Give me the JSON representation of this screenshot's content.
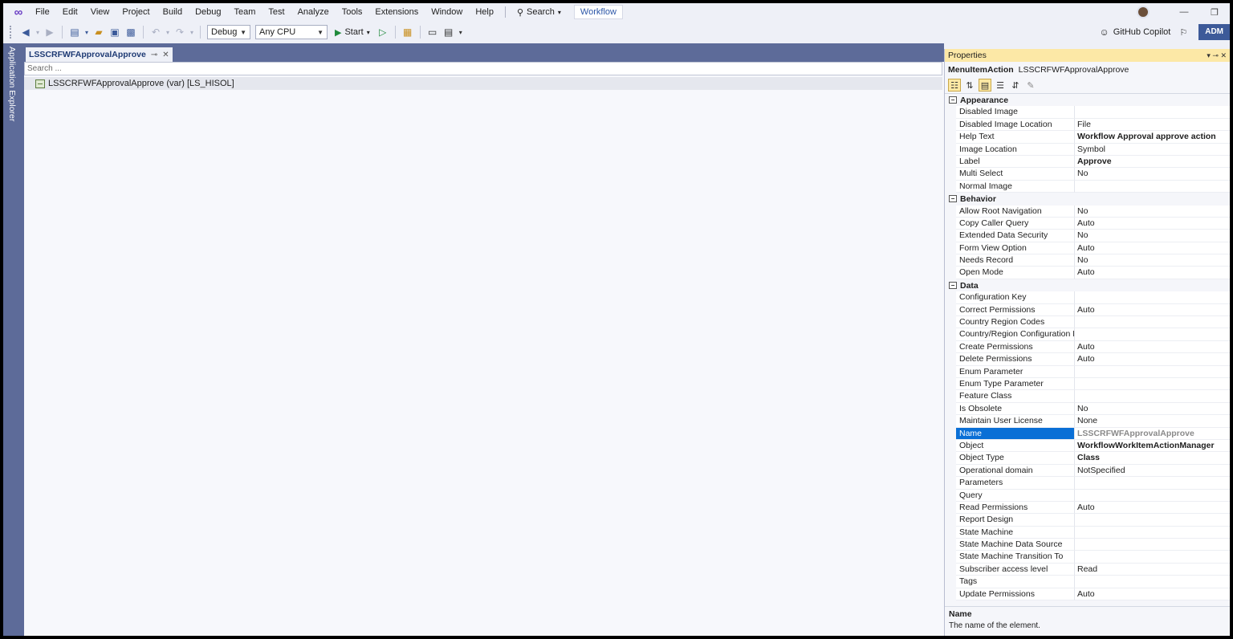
{
  "menubar": {
    "items": [
      "File",
      "Edit",
      "View",
      "Project",
      "Build",
      "Debug",
      "Team",
      "Test",
      "Analyze",
      "Tools",
      "Extensions",
      "Window",
      "Help"
    ],
    "search_label": "Search",
    "solution_badge": "Workflow"
  },
  "toolbar": {
    "config": "Debug",
    "platform": "Any CPU",
    "start_label": "Start",
    "copilot_label": "GitHub Copilot",
    "account": "ADM"
  },
  "side": {
    "app_explorer": "Application Explorer"
  },
  "document": {
    "tab_title": "LSSCRFWFApprovalApprove",
    "search_placeholder": "Search ...",
    "tree_item": "LSSCRFWFApprovalApprove (var) [LS_HISOL]"
  },
  "properties": {
    "title": "Properties",
    "object_kind": "MenuItemAction",
    "object_name": "LSSCRFWFApprovalApprove",
    "categories": [
      {
        "name": "Appearance",
        "rows": [
          {
            "name": "Disabled Image",
            "value": "",
            "bold": false
          },
          {
            "name": "Disabled Image Location",
            "value": "File",
            "bold": false
          },
          {
            "name": "Help Text",
            "value": "Workflow Approval approve action",
            "bold": true
          },
          {
            "name": "Image Location",
            "value": "Symbol",
            "bold": false
          },
          {
            "name": "Label",
            "value": "Approve",
            "bold": true
          },
          {
            "name": "Multi Select",
            "value": "No",
            "bold": false
          },
          {
            "name": "Normal Image",
            "value": "",
            "bold": false
          }
        ]
      },
      {
        "name": "Behavior",
        "rows": [
          {
            "name": "Allow Root Navigation",
            "value": "No",
            "bold": false
          },
          {
            "name": "Copy Caller Query",
            "value": "Auto",
            "bold": false
          },
          {
            "name": "Extended Data Security",
            "value": "No",
            "bold": false
          },
          {
            "name": "Form View Option",
            "value": "Auto",
            "bold": false
          },
          {
            "name": "Needs Record",
            "value": "No",
            "bold": false
          },
          {
            "name": "Open Mode",
            "value": "Auto",
            "bold": false
          }
        ]
      },
      {
        "name": "Data",
        "rows": [
          {
            "name": "Configuration Key",
            "value": "",
            "bold": false
          },
          {
            "name": "Correct Permissions",
            "value": "Auto",
            "bold": false
          },
          {
            "name": "Country Region Codes",
            "value": "",
            "bold": false
          },
          {
            "name": "Country/Region Configuration Ke",
            "value": "",
            "bold": false
          },
          {
            "name": "Create Permissions",
            "value": "Auto",
            "bold": false
          },
          {
            "name": "Delete Permissions",
            "value": "Auto",
            "bold": false
          },
          {
            "name": "Enum Parameter",
            "value": "",
            "bold": false
          },
          {
            "name": "Enum Type Parameter",
            "value": "",
            "bold": false
          },
          {
            "name": "Feature Class",
            "value": "",
            "bold": false
          },
          {
            "name": "Is Obsolete",
            "value": "No",
            "bold": false
          },
          {
            "name": "Maintain User License",
            "value": "None",
            "bold": false
          },
          {
            "name": "Name",
            "value": "LSSCRFWFApprovalApprove",
            "bold": true,
            "selected": true
          },
          {
            "name": "Object",
            "value": "WorkflowWorkItemActionManager",
            "bold": true
          },
          {
            "name": "Object Type",
            "value": "Class",
            "bold": true
          },
          {
            "name": "Operational domain",
            "value": "NotSpecified",
            "bold": false
          },
          {
            "name": "Parameters",
            "value": "",
            "bold": false
          },
          {
            "name": "Query",
            "value": "",
            "bold": false
          },
          {
            "name": "Read Permissions",
            "value": "Auto",
            "bold": false
          },
          {
            "name": "Report Design",
            "value": "",
            "bold": false
          },
          {
            "name": "State Machine",
            "value": "",
            "bold": false
          },
          {
            "name": "State Machine Data Source",
            "value": "",
            "bold": false
          },
          {
            "name": "State Machine Transition To",
            "value": "",
            "bold": false
          },
          {
            "name": "Subscriber access level",
            "value": "Read",
            "bold": false
          },
          {
            "name": "Tags",
            "value": "",
            "bold": false
          },
          {
            "name": "Update Permissions",
            "value": "Auto",
            "bold": false
          }
        ]
      }
    ],
    "description_title": "Name",
    "description_text": "The name of the element."
  }
}
